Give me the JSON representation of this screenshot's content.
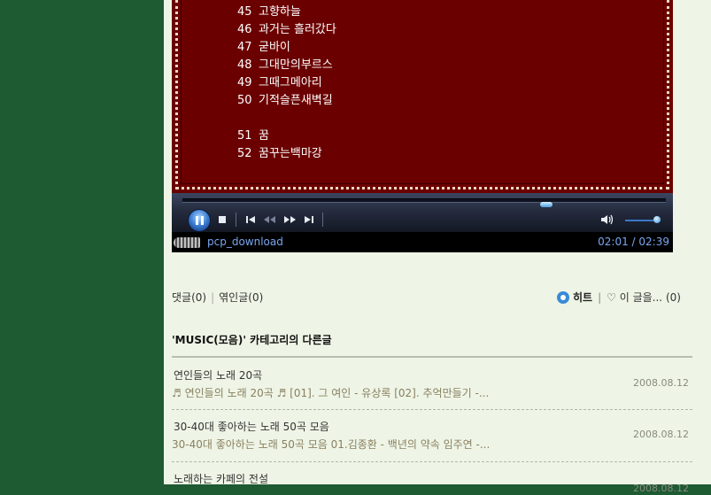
{
  "songs": [
    {
      "num": "45",
      "title": "고향하늘"
    },
    {
      "num": "46",
      "title": "과거는 흘러갔다"
    },
    {
      "num": "47",
      "title": "굳바이"
    },
    {
      "num": "48",
      "title": "그대만의부르스"
    },
    {
      "num": "49",
      "title": "그때그메아리"
    },
    {
      "num": "50",
      "title": "기적슬픈새벽길"
    },
    {
      "num": "51",
      "title": "꿈"
    },
    {
      "num": "52",
      "title": "꿈꾸는백마강"
    }
  ],
  "player": {
    "filename": "pcp_download",
    "time": "02:01 / 02:39",
    "progress": 0.76,
    "volume": 0.9
  },
  "comments": {
    "reply": "댓글(0)",
    "trackback": "엮인글(0)"
  },
  "hit": {
    "label": "히트",
    "like_label": "이 글을...",
    "like_count": "(0)"
  },
  "other": {
    "title": "'MUSIC(모음)' 카테고리의 다른글",
    "posts": [
      {
        "title": "연인들의 노래 20곡",
        "summary": "♬ 연인들의 노래 20곡 ♬ [01]. 그 여인 - 유상록 [02]. 추억만들기 -...",
        "date": "2008.08.12"
      },
      {
        "title": "30-40대 좋아하는 노래 50곡 모음",
        "summary": "30-40대 좋아하는 노래 50곡 모음 01.김종환 - 백년의 약속 임주연 -...",
        "date": "2008.08.12"
      },
      {
        "title": "노래하는 카페의 전설",
        "summary": "",
        "date": "2008.08.12"
      }
    ]
  },
  "colors": {
    "page_bg": "#1e5a32",
    "content_bg": "#eef5e6",
    "songbox_bg": "#6b0000",
    "status_text": "#7aa6f0"
  }
}
